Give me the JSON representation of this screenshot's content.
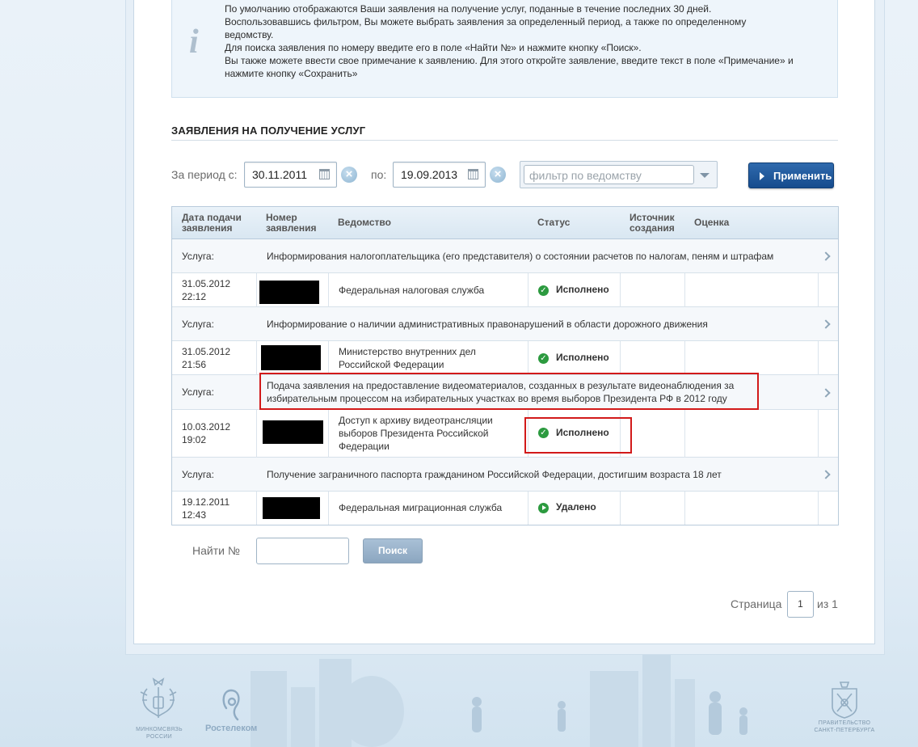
{
  "info": {
    "lines": [
      "По умолчанию отображаются Ваши заявления на получение услуг, поданные в течение последних 30 дней.",
      "Воспользовавшись фильтром, Вы можете выбрать заявления за определенный период, а также по определенному",
      "ведомству.",
      "Для поиска заявления по номеру введите его в поле «Найти №» и  нажмите кнопку «Поиск».",
      "Вы также можете ввести свое примечание к заявлению. Для этого откройте заявление, введите текст в поле «Примечание» и",
      "нажмите кнопку «Сохранить»"
    ]
  },
  "section": {
    "title": "ЗАЯВЛЕНИЯ НА ПОЛУЧЕНИЕ УСЛУГ"
  },
  "filter": {
    "period_from_label": "За период с:",
    "date_from": "30.11.2011",
    "to_label": "по:",
    "date_to": "19.09.2013",
    "department_placeholder": "фильтр по ведомству",
    "apply_label": "Применить"
  },
  "table": {
    "headers": {
      "date": [
        "Дата подачи",
        "заявления"
      ],
      "number": [
        "Номер",
        "заявления"
      ],
      "department": "Ведомство",
      "status": "Статус",
      "source": [
        "Источник",
        "создания"
      ],
      "rating": "Оценка"
    },
    "service_label": "Услуга:",
    "groups": [
      {
        "service": [
          "Информирования налогоплательщика (его представителя) о состоянии расчетов по налогам, пеням и штрафам"
        ],
        "date": [
          "31.05.2012",
          "22:12"
        ],
        "department": [
          "Федеральная налоговая служба"
        ],
        "status": "Исполнено",
        "status_type": "done"
      },
      {
        "service": [
          "Информирование о наличии административных правонарушений в области дорожного движения"
        ],
        "date": [
          "31.05.2012",
          "21:56"
        ],
        "department": [
          "Министерство внутренних дел",
          "Российской Федерации"
        ],
        "status": "Исполнено",
        "status_type": "done"
      },
      {
        "service": [
          "Подача заявления на предоставление видеоматериалов, созданных в результате видеонаблюдения за",
          "избирательным процессом на избирательных участках во время выборов Президента РФ в 2012 году"
        ],
        "date": [
          "10.03.2012",
          "19:02"
        ],
        "department": [
          "Доступ к архиву видеотрансляции",
          "выборов Президента Российской",
          "Федерации"
        ],
        "status": "Исполнено",
        "status_type": "done"
      },
      {
        "service": [
          "Получение заграничного паспорта гражданином Российской Федерации, достигшим возраста 18 лет"
        ],
        "date": [
          "19.12.2011",
          "12:43"
        ],
        "department": [
          "Федеральная миграционная служба"
        ],
        "status": "Удалено",
        "status_type": "deleted"
      }
    ]
  },
  "search": {
    "label": "Найти №",
    "value": "",
    "button_label": "Поиск"
  },
  "pager": {
    "page_label": "Страница",
    "current": "1",
    "of_label": "из 1"
  },
  "footer": {
    "minsvyaz": [
      "МИНКОМСВЯЗЬ",
      "РОССИИ"
    ],
    "rostelecom": "Ростелеком",
    "spb": [
      "ПРАВИТЕЛЬСТВО",
      "САНКТ-ПЕТЕРБУРГА"
    ]
  },
  "colors": {
    "accent": "#1f5a9e",
    "highlight": "#d21a1a",
    "status_ok": "#2c9a3f"
  }
}
